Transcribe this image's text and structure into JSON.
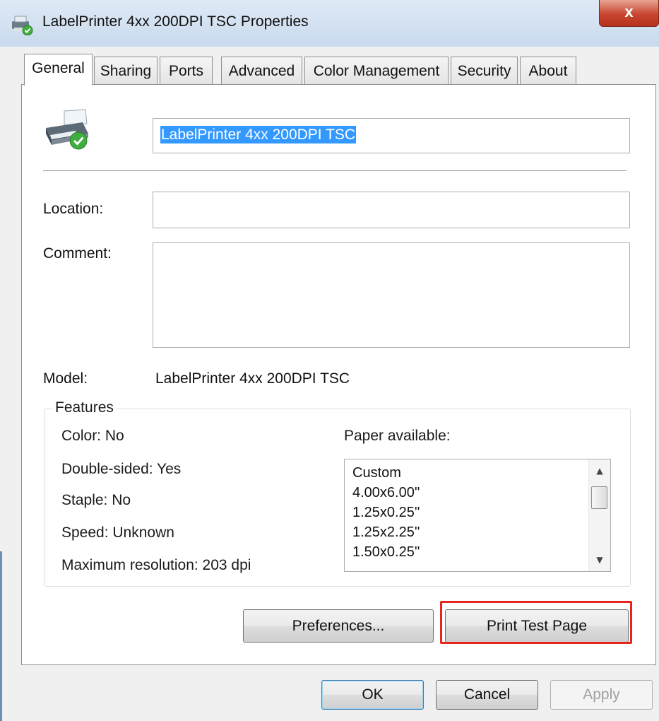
{
  "window": {
    "title": "LabelPrinter 4xx 200DPI TSC Properties",
    "close_label": "x"
  },
  "tabs": [
    {
      "label": "General",
      "active": true
    },
    {
      "label": "Sharing",
      "active": false
    },
    {
      "label": "Ports",
      "active": false
    },
    {
      "label": "Advanced",
      "active": false
    },
    {
      "label": "Color Management",
      "active": false
    },
    {
      "label": "Security",
      "active": false
    },
    {
      "label": "About",
      "active": false
    }
  ],
  "general": {
    "printer_name": "LabelPrinter 4xx 200DPI TSC",
    "location_label": "Location:",
    "location_value": "",
    "comment_label": "Comment:",
    "comment_value": "",
    "model_label": "Model:",
    "model_value": "LabelPrinter 4xx 200DPI TSC"
  },
  "features": {
    "legend": "Features",
    "color": "Color: No",
    "double_sided": "Double-sided: Yes",
    "staple": "Staple: No",
    "speed": "Speed: Unknown",
    "max_resolution": "Maximum resolution: 203 dpi",
    "paper_label": "Paper available:",
    "paper_options": [
      "Custom",
      "4.00x6.00''",
      "1.25x0.25''",
      "1.25x2.25''",
      "1.50x0.25''"
    ]
  },
  "buttons": {
    "preferences": "Preferences...",
    "print_test_page": "Print Test Page",
    "ok": "OK",
    "cancel": "Cancel",
    "apply": "Apply"
  },
  "colors": {
    "selection": "#3399ff",
    "highlight_box": "#e8251d",
    "close_button": "#c7452f"
  }
}
